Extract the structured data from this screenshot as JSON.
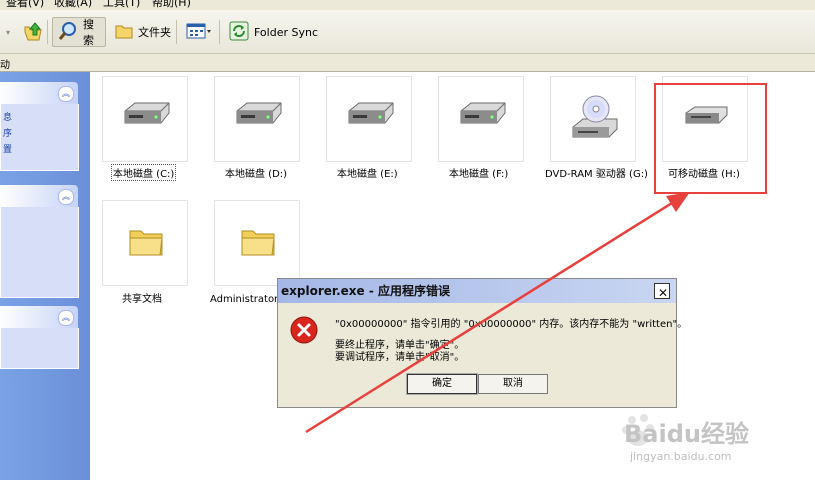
{
  "menu": [
    "查看(V)",
    "收藏(A)",
    "工具(T)",
    "帮助(H)"
  ],
  "toolbar": {
    "search_label": "搜索",
    "folders_label": "文件夹",
    "folder_sync_label": "Folder Sync"
  },
  "address": {
    "label": "动"
  },
  "left_pane": {
    "links": [
      "息",
      "序",
      "置"
    ]
  },
  "items": [
    {
      "label": "本地磁盘 (C:)",
      "icon": "hard-drive-icon"
    },
    {
      "label": "本地磁盘 (D:)",
      "icon": "hard-drive-icon"
    },
    {
      "label": "本地磁盘 (E:)",
      "icon": "hard-drive-icon"
    },
    {
      "label": "本地磁盘 (F:)",
      "icon": "hard-drive-icon"
    },
    {
      "label": "DVD-RAM 驱动器 (G:)",
      "icon": "dvd-drive-icon"
    },
    {
      "label": "可移动磁盘 (H:)",
      "icon": "removable-disk-icon"
    },
    {
      "label": "共享文档",
      "icon": "folder-icon"
    },
    {
      "label": "Administrator 的",
      "icon": "folder-icon"
    }
  ],
  "dialog": {
    "title": "explorer.exe - 应用程序错误",
    "message": "\"0x00000000\" 指令引用的 \"0x00000000\" 内存。该内存不能为 \"written\"。",
    "line1": "要终止程序，请单击\"确定\"。",
    "line2": "要调试程序，请单击\"取消\"。",
    "ok": "确定",
    "cancel": "取消"
  },
  "watermark": {
    "brand": "Baidu经验",
    "url": "jingyan.baidu.com"
  },
  "colors": {
    "highlight": "#e8403c",
    "arrow": "#e8403c",
    "task_pane": "#7aa2e5"
  }
}
